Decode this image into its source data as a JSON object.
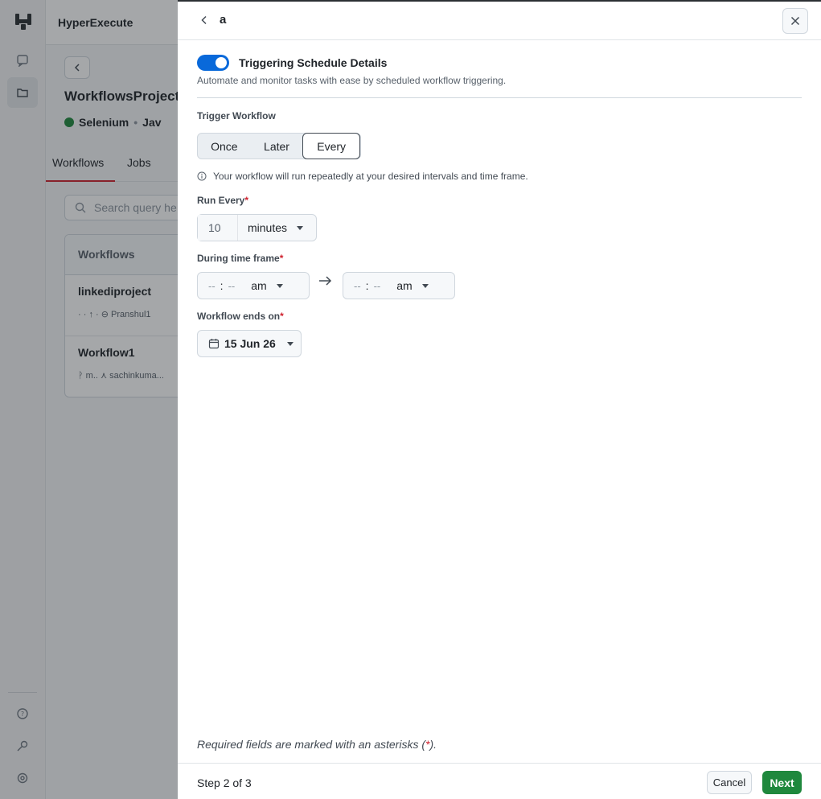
{
  "background": {
    "app_title": "HyperExecute",
    "project_name": "WorkflowsProject",
    "meta_framework": "Selenium",
    "meta_language": "Jav",
    "tabs": [
      "Workflows",
      "Jobs"
    ],
    "search_placeholder": "Search query he",
    "table_header": "Workflows",
    "rows": [
      {
        "title": "linkediproject",
        "sub": "· · ↑ ·   ⊖ Pranshul1"
      },
      {
        "title": "Workflow1",
        "sub": "ᚹ m..   ⋏ sachinkuma..."
      }
    ]
  },
  "drawer": {
    "title": "a",
    "section_title": "Triggering Schedule Details",
    "section_subtitle": "Automate and monitor tasks with ease by scheduled workflow triggering.",
    "toggle_on": true,
    "trigger_label": "Trigger Workflow",
    "trigger_options": [
      "Once",
      "Later",
      "Every"
    ],
    "trigger_selected": "Every",
    "info_text": "Your workflow will run repeatedly at your desired intervals and time frame.",
    "run_every_label": "Run Every",
    "run_every_value": "10",
    "run_every_unit": "minutes",
    "time_frame_label": "During time frame",
    "time_start": {
      "hh": "--",
      "mm": "--",
      "ampm": "am"
    },
    "time_end": {
      "hh": "--",
      "mm": "--",
      "ampm": "am"
    },
    "ends_on_label": "Workflow ends on",
    "ends_on_value": "15 Jun 26",
    "required_mark": "*",
    "footnote_before": "Required fields are marked with an asterisks (",
    "footnote_after": ").",
    "step_text": "Step 2 of 3",
    "cancel_label": "Cancel",
    "next_label": "Next"
  },
  "colors": {
    "accent": "#0969da",
    "primary_button": "#1f883d",
    "required": "#cf222e"
  }
}
